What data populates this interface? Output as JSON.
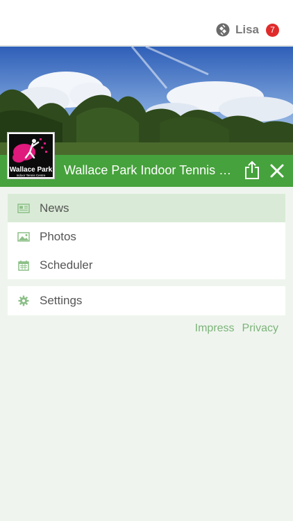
{
  "user": {
    "name": "Lisa",
    "badge_count": "7"
  },
  "club": {
    "title": "Wallace Park Indoor Tennis Centre",
    "logo_name": "Wallace Park",
    "logo_subtitle": "Indoor Tennis Centre"
  },
  "menu": {
    "items": [
      {
        "label": "News",
        "icon": "newspaper-icon",
        "active": true
      },
      {
        "label": "Photos",
        "icon": "image-icon",
        "active": false
      },
      {
        "label": "Scheduler",
        "icon": "calendar-icon",
        "active": false
      }
    ],
    "settings_label": "Settings"
  },
  "footer": {
    "impress": "Impress",
    "privacy": "Privacy"
  },
  "colors": {
    "accent_green": "#46a23c",
    "active_row": "#d9ebd6",
    "badge_red": "#e02b2b",
    "background": "#eff5ee",
    "link_green": "#7db37a"
  }
}
